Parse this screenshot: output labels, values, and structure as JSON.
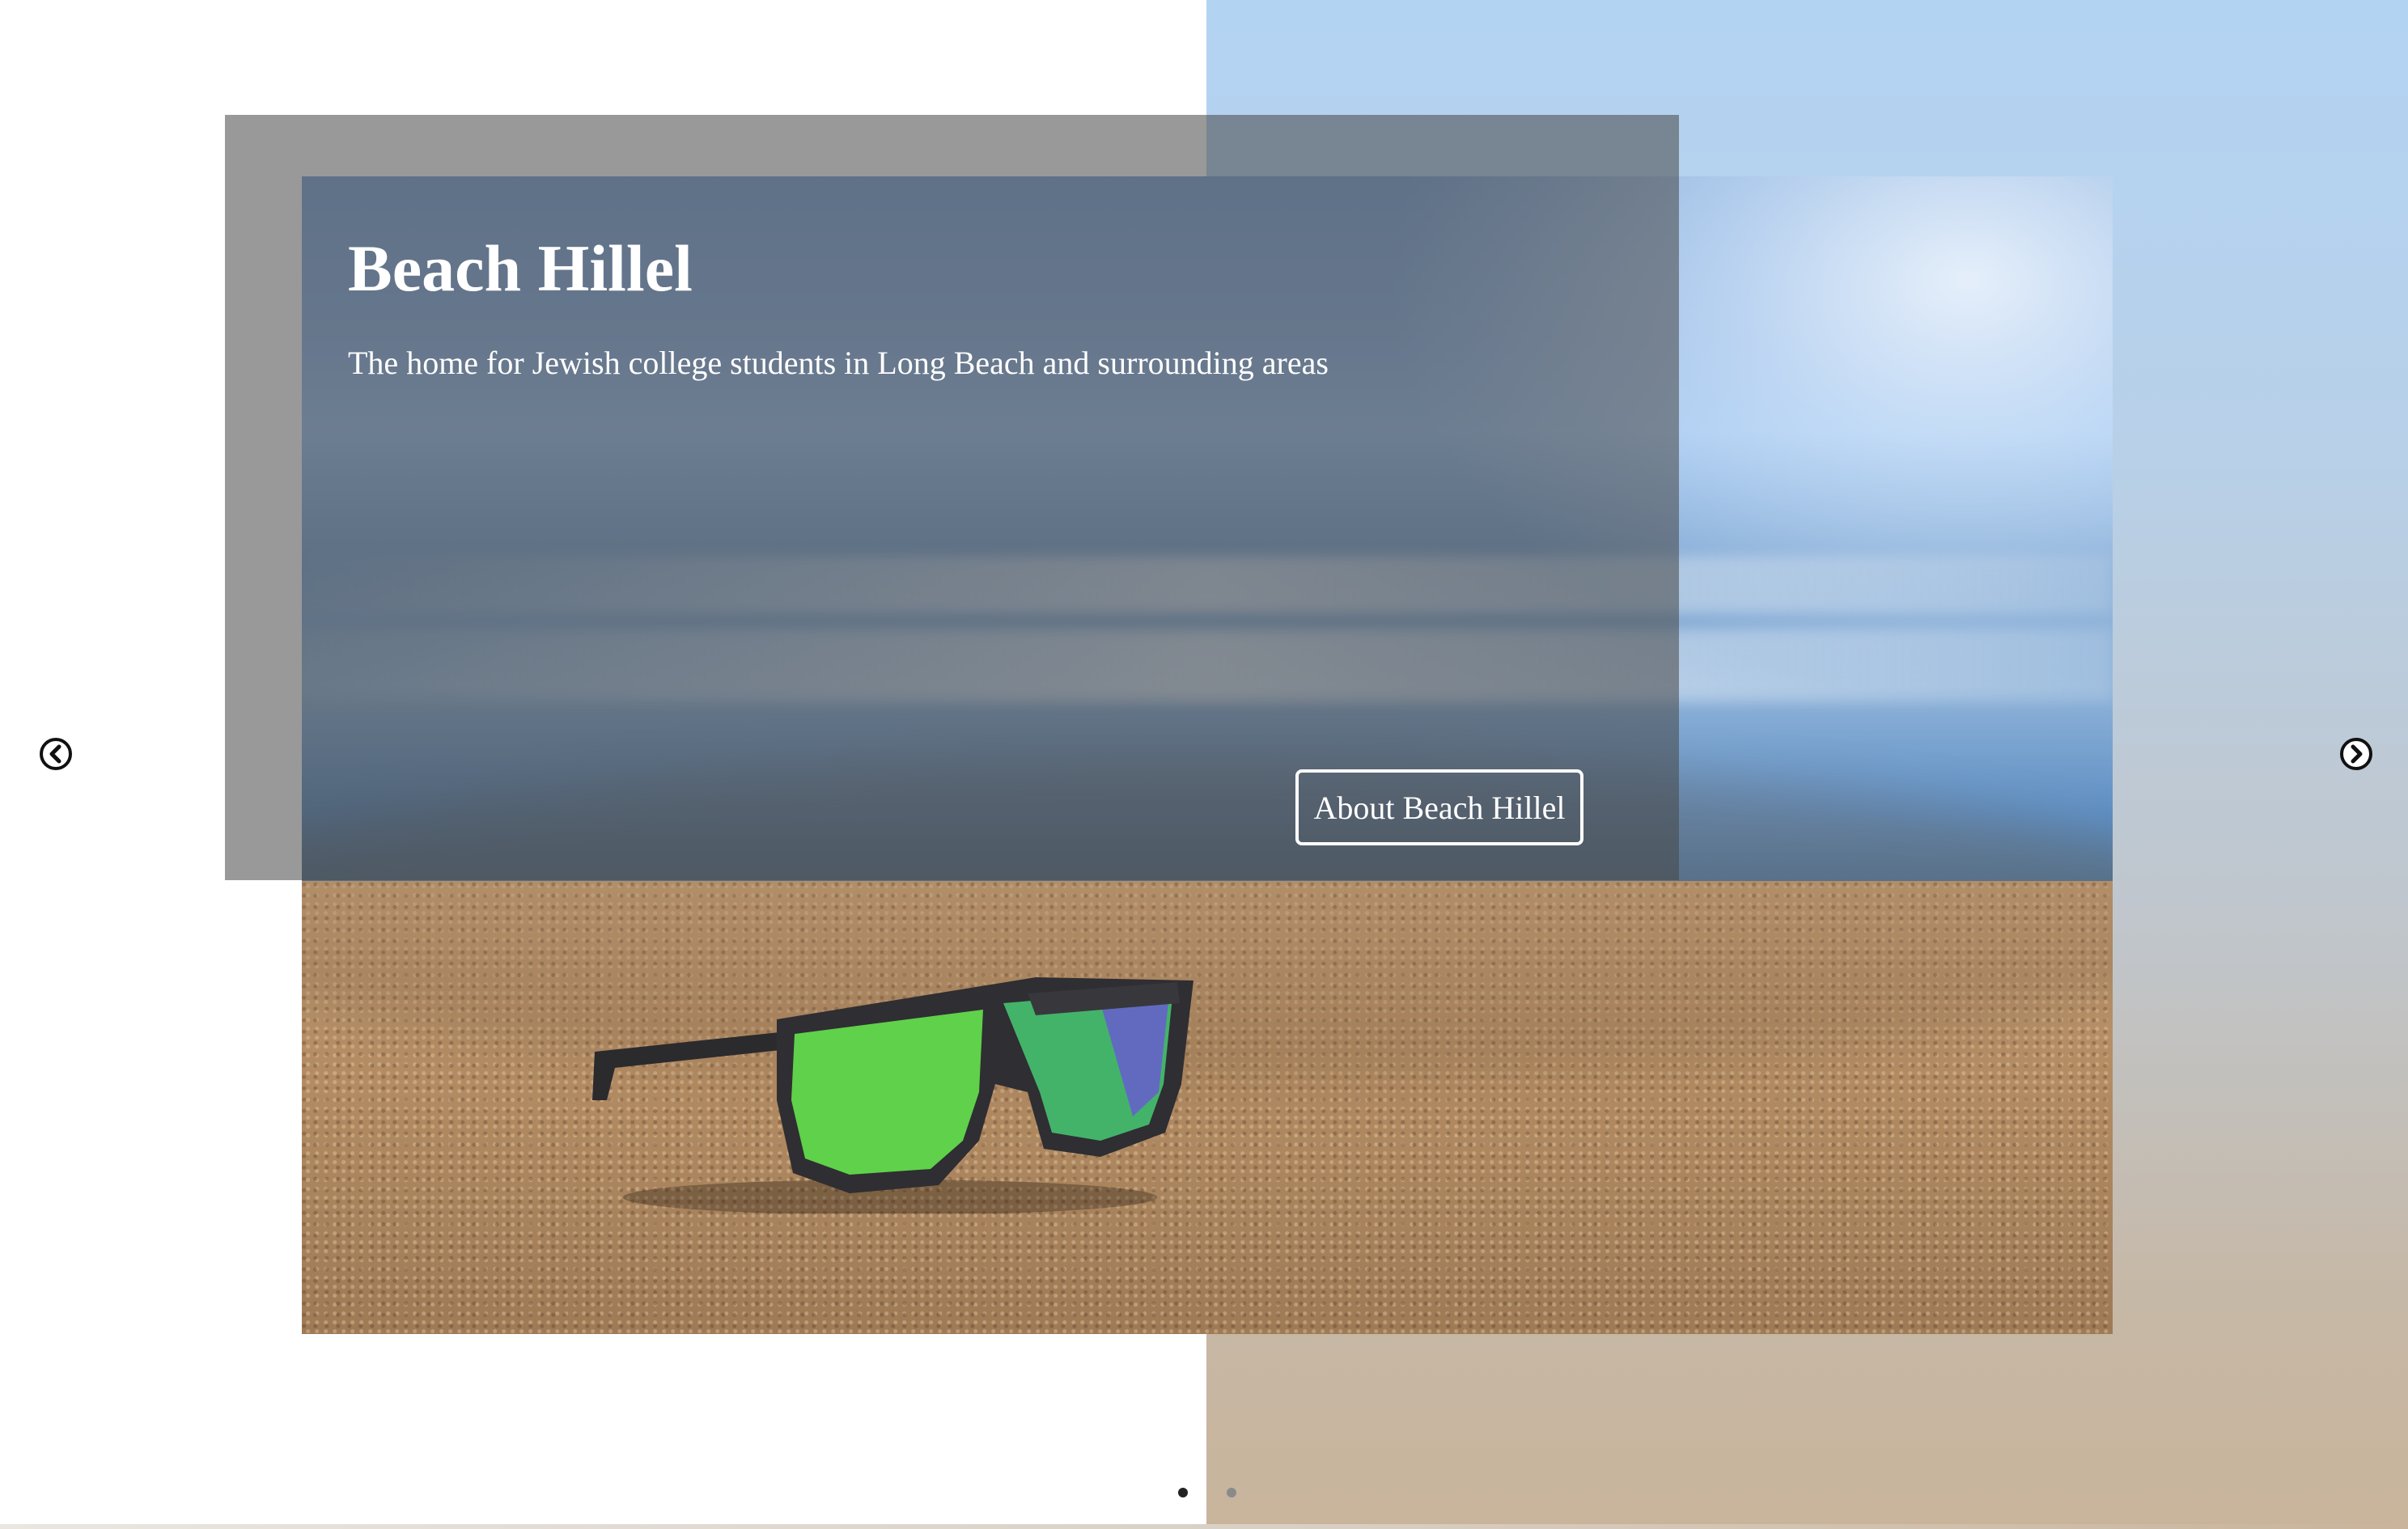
{
  "slider": {
    "title": "Beach Hillel",
    "subtitle": "The home for Jewish college students in Long Beach and surrounding areas",
    "cta_label": "About Beach Hillel",
    "prev_icon": "chevron-left-icon",
    "next_icon": "chevron-right-icon",
    "slide_count": 2,
    "active_slide": 1,
    "colors": {
      "caption_overlay": "#464646",
      "text": "#ffffff",
      "dot_active": "#222222",
      "dot_inactive": "#8a8a8a"
    }
  }
}
